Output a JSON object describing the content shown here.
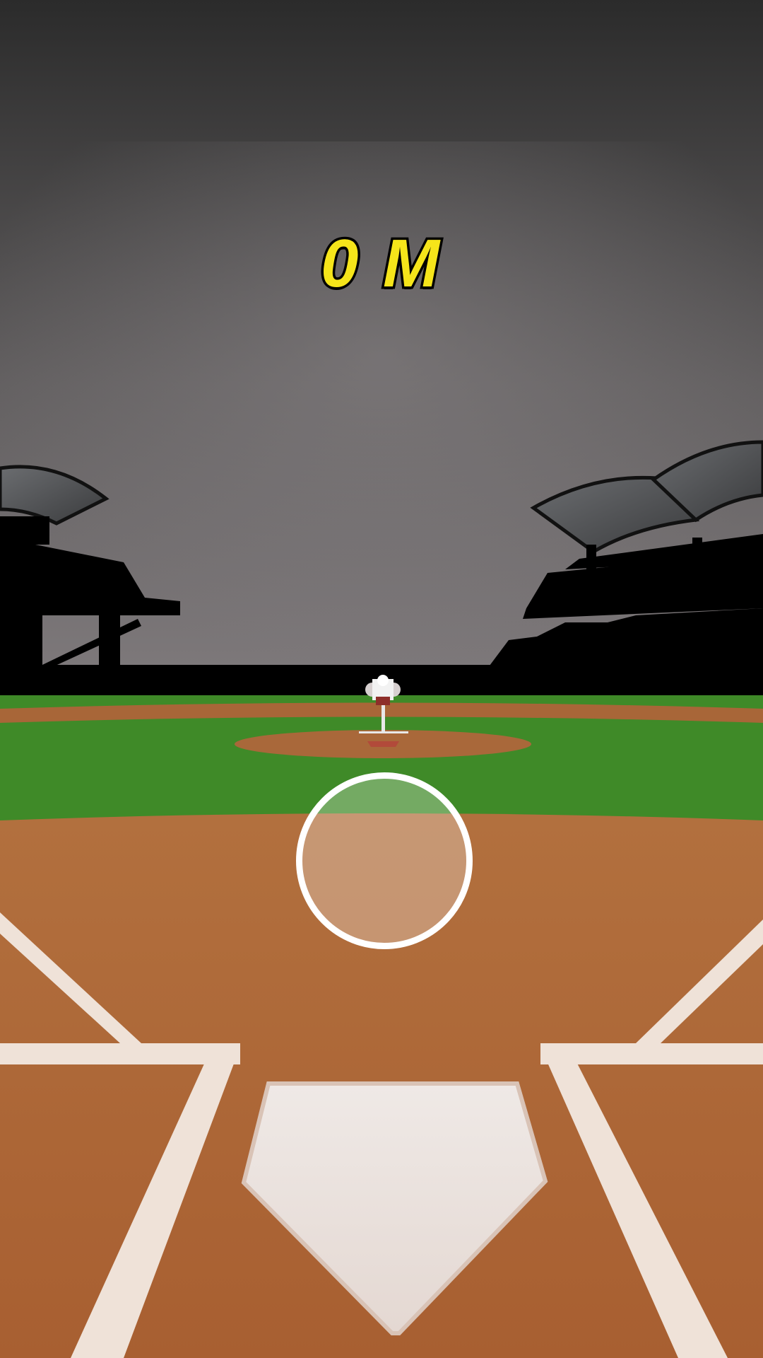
{
  "hud": {
    "distance_label": "0 M",
    "distance_color": "#f6e51a"
  },
  "aim": {
    "icon": "circle-target-icon"
  },
  "colors": {
    "sky_top": "#2b2b2b",
    "sky_bottom": "#7d787a",
    "grass": "#3f8a28",
    "dirt": "#b06a38",
    "chalk": "#f1e6dc",
    "stadium": "#000000"
  }
}
